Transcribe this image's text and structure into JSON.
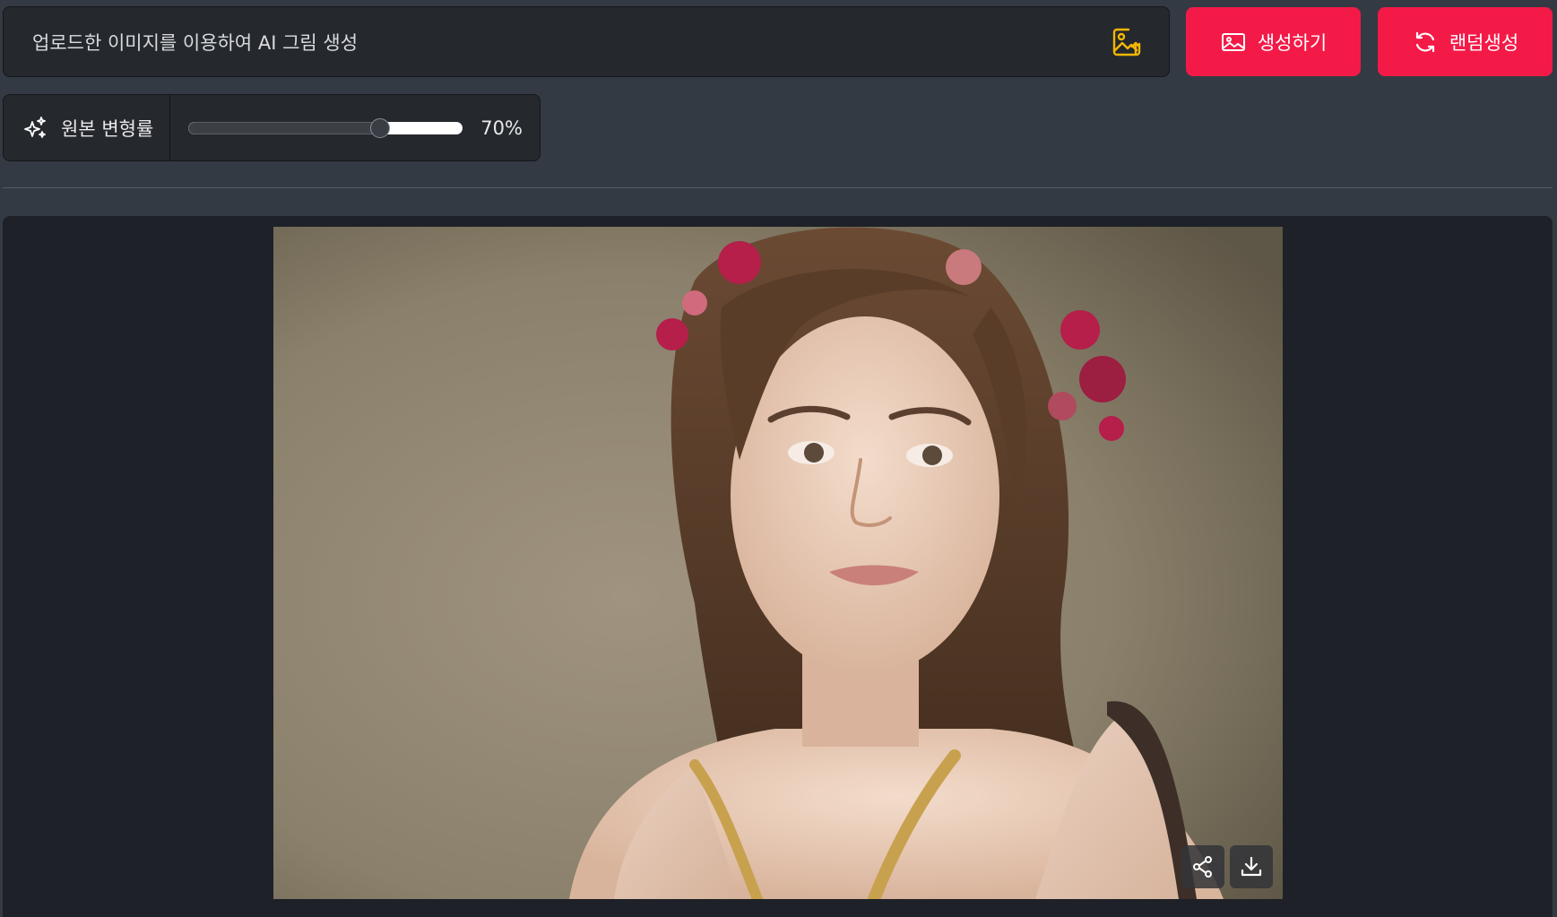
{
  "prompt": {
    "text": "업로드한 이미지를 이용하여 AI 그림 생성",
    "upload_icon": "image-upload-icon"
  },
  "buttons": {
    "generate_label": "생성하기",
    "random_label": "랜덤생성",
    "generate_icon": "image-icon",
    "random_icon": "refresh-icon",
    "color": "#f31a48"
  },
  "strength": {
    "label": "원본 변형률",
    "value": 70,
    "value_text": "70%",
    "icon": "sparkle-icon"
  },
  "result": {
    "share_icon": "share-icon",
    "download_icon": "download-icon"
  },
  "colors": {
    "background": "#343a43",
    "panel": "#1e2127",
    "accent_icon": "#f2b705"
  }
}
